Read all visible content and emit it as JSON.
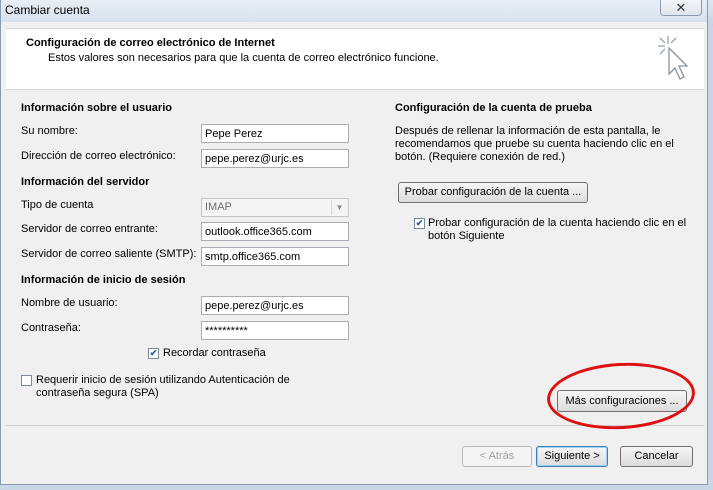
{
  "window": {
    "title": "Cambiar cuenta",
    "close_label": "✕"
  },
  "header": {
    "title": "Configuración de correo electrónico de Internet",
    "subtitle": "Estos valores son necesarios para que la cuenta de correo electrónico funcione."
  },
  "user_info": {
    "heading": "Información sobre el usuario",
    "name_label": "Su nombre:",
    "name_value": "Pepe Perez",
    "email_label": "Dirección de correo electrónico:",
    "email_value": "pepe.perez@urjc.es"
  },
  "server_info": {
    "heading": "Información del servidor",
    "account_type_label": "Tipo de cuenta",
    "account_type_value": "IMAP",
    "incoming_label": "Servidor de correo entrante:",
    "incoming_value": "outlook.office365.com",
    "outgoing_label": "Servidor de correo saliente (SMTP):",
    "outgoing_value": "smtp.office365.com"
  },
  "login_info": {
    "heading": "Información de inicio de sesión",
    "username_label": "Nombre de usuario:",
    "username_value": "pepe.perez@urjc.es",
    "password_label": "Contraseña:",
    "password_value": "**********",
    "remember_label": "Recordar contraseña",
    "remember_checked": true,
    "spa_label": "Requerir inicio de sesión utilizando Autenticación de contraseña segura (SPA)",
    "spa_checked": false
  },
  "test_settings": {
    "heading": "Configuración de la cuenta de prueba",
    "description": "Después de rellenar la información de esta pantalla, le recomendamos que pruebe su cuenta haciendo clic en el botón. (Requiere conexión de red.)",
    "test_button": "Probar configuración de la cuenta ...",
    "auto_test_label": "Probar configuración de la cuenta haciendo clic en el botón Siguiente",
    "auto_test_checked": true
  },
  "more_settings_button": "Más configuraciones ...",
  "footer": {
    "back_button": "< Atrás",
    "next_button": "Siguiente >",
    "cancel_button": "Cancelar"
  },
  "colors": {
    "highlight_ellipse": "#e01010",
    "dialog_bg": "#f0f0f0"
  }
}
